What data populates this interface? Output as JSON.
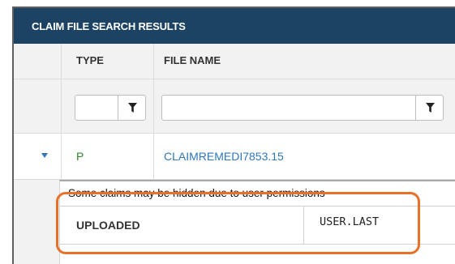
{
  "panel": {
    "title": "CLAIM FILE SEARCH RESULTS",
    "columns": {
      "type": "TYPE",
      "file_name": "FILE NAME"
    },
    "filters": {
      "type_value": "",
      "file_name_value": ""
    }
  },
  "rows": [
    {
      "type": "P",
      "file_name": "CLAIMREMEDI7853.15"
    }
  ],
  "detail": {
    "notice": "Some claims may be hidden due to user permissions",
    "field_label": "UPLOADED",
    "field_value": "USER.LAST"
  },
  "icons": {
    "filter": "filter-icon",
    "expand": "caret-down-icon"
  },
  "colors": {
    "title_bar": "#1c4364",
    "type_text": "#2d8a2d",
    "link": "#2f77b8",
    "highlight": "#e8712a"
  }
}
